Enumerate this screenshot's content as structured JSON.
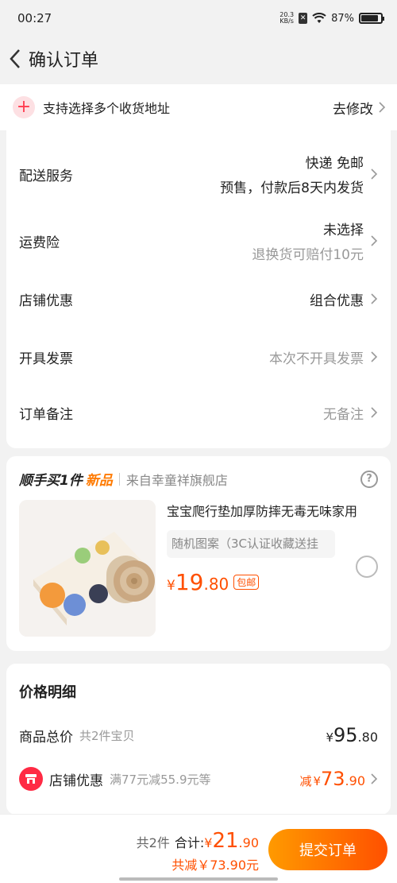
{
  "status": {
    "time": "00:27",
    "netspeed_top": "20.3",
    "netspeed_bottom": "KB/s",
    "battery": "87%",
    "battery_level": 0.87
  },
  "nav": {
    "title": "确认订单"
  },
  "address": {
    "text": "支持选择多个收货地址",
    "action": "去修改"
  },
  "settings": {
    "delivery": {
      "label": "配送服务",
      "line1": "快递 免邮",
      "line2": "预售，付款后8天内发货"
    },
    "insurance": {
      "label": "运费险",
      "line1": "未选择",
      "line2": "退换货可赔付10元"
    },
    "shop_discount": {
      "label": "店铺优惠",
      "value": "组合优惠"
    },
    "invoice": {
      "label": "开具发票",
      "value": "本次不开具发票"
    },
    "note": {
      "label": "订单备注",
      "value": "无备注"
    }
  },
  "deal": {
    "title_a": "顺手买1件",
    "title_b": "新品",
    "store": "来自幸童祥旗舰店",
    "help": "?",
    "product_name": "宝宝爬行垫加厚防摔无毒无味家用",
    "spec": "随机图案（3C认证收藏送挂",
    "price_yen": "¥",
    "price_int": "19",
    "price_dec": ".80",
    "badge": "包邮"
  },
  "detail": {
    "title": "价格明细",
    "total_label": "商品总价",
    "total_sub": "共2件宝贝",
    "total_yen": "¥",
    "total_int": "95",
    "total_dec": ".80",
    "shop_label": "店铺优惠",
    "shop_sub": "满77元减55.9元等",
    "shop_prefix": "减",
    "shop_yen": "¥",
    "shop_int": "73",
    "shop_dec": ".90"
  },
  "bottom": {
    "count": "共2件",
    "total_label": "合计:",
    "yen": "¥",
    "int": "21",
    "dec": ".90",
    "saved": "共减￥73.90元",
    "submit": "提交订单"
  },
  "colors": {
    "accent": "#ff4f00",
    "brand_red": "#ff2a44",
    "orange": "#ff7a00"
  }
}
